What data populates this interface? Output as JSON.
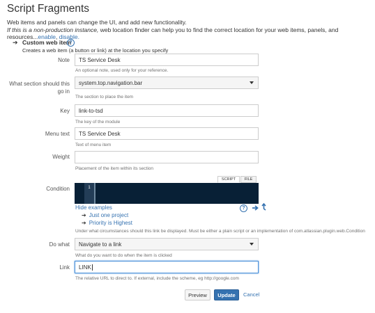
{
  "page": {
    "title": "Script Fragments",
    "intro_line1": "Web items and panels can change the UI, and add new functionality.",
    "intro_line2_italic": "If this is a non-production instance,",
    "intro_line2_rest": " web location finder can help you to find the correct location for your web items, panels, and resources...",
    "enable_label": "enable",
    "separator": ",",
    "disable_label": "disable."
  },
  "section": {
    "arrow": "➔",
    "title": "Custom web item",
    "description": "Creates a web item (a button or link) at the location you specify"
  },
  "form": {
    "note": {
      "label": "Note",
      "value": "TS Service Desk",
      "description": "An optional note, used only for your reference."
    },
    "section": {
      "label": "What section should this go in",
      "value": "system.top.navigation.bar",
      "description": "The section to place the item"
    },
    "key": {
      "label": "Key",
      "value": "link-to-tsd",
      "description": "The key of the module"
    },
    "menu_text": {
      "label": "Menu text",
      "value": "TS Service Desk",
      "description": "Text of menu item"
    },
    "weight": {
      "label": "Weight",
      "value": "",
      "description": "Placement of the item within its section"
    },
    "condition": {
      "label": "Condition",
      "tab_script": "SCRIPT",
      "tab_file": "FILE",
      "line_number": "1",
      "hide_examples": "Hide examples",
      "examples": [
        "Just one project",
        "Priority is Highest"
      ],
      "description": "Under what circumstances should this link be displayed. Must be either a plain script or an implementation of com.atlassian.plugin.web.Condition"
    },
    "do_what": {
      "label": "Do what",
      "value": "Navigate to a link",
      "description": "What do you want to do when the item is clicked"
    },
    "link": {
      "label": "Link",
      "value": "LINK",
      "description": "The relative URL to direct to. If external, include the scheme, eg http://google.com"
    }
  },
  "buttons": {
    "preview": "Preview",
    "update": "Update",
    "cancel": "Cancel"
  },
  "icons": {
    "help": "?",
    "bullet": "➔"
  },
  "colors": {
    "accent": "#3572b0",
    "editor_bg": "#082036"
  }
}
